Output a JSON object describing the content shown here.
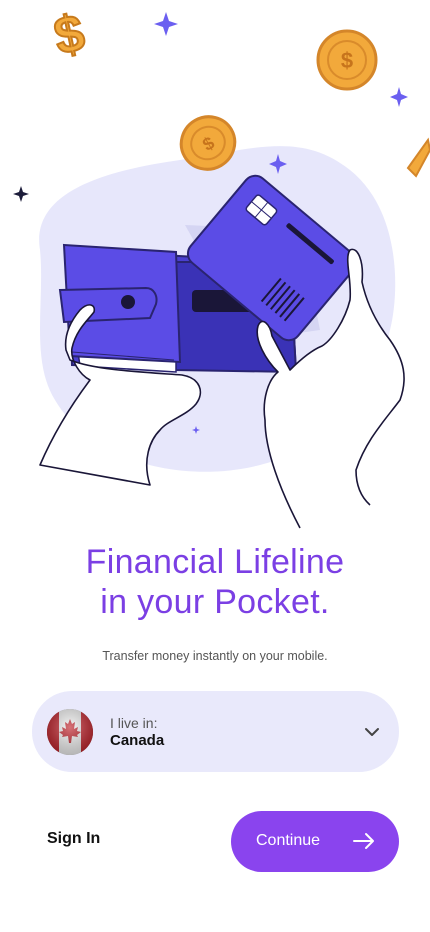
{
  "headline": {
    "line1": "Financial Lifeline",
    "line2": "in your Pocket."
  },
  "subtitle": "Transfer money instantly on your mobile.",
  "country_selector": {
    "label": "I live in:",
    "value": "Canada",
    "icon": "chevron-down-icon"
  },
  "actions": {
    "sign_in": "Sign In",
    "continue": "Continue",
    "continue_icon": "arrow-right-icon"
  },
  "colors": {
    "accent": "#8a44ee",
    "headline": "#7b3fe4",
    "card_bg": "#e9e9fb",
    "illustration_purple": "#5b4ce6"
  }
}
